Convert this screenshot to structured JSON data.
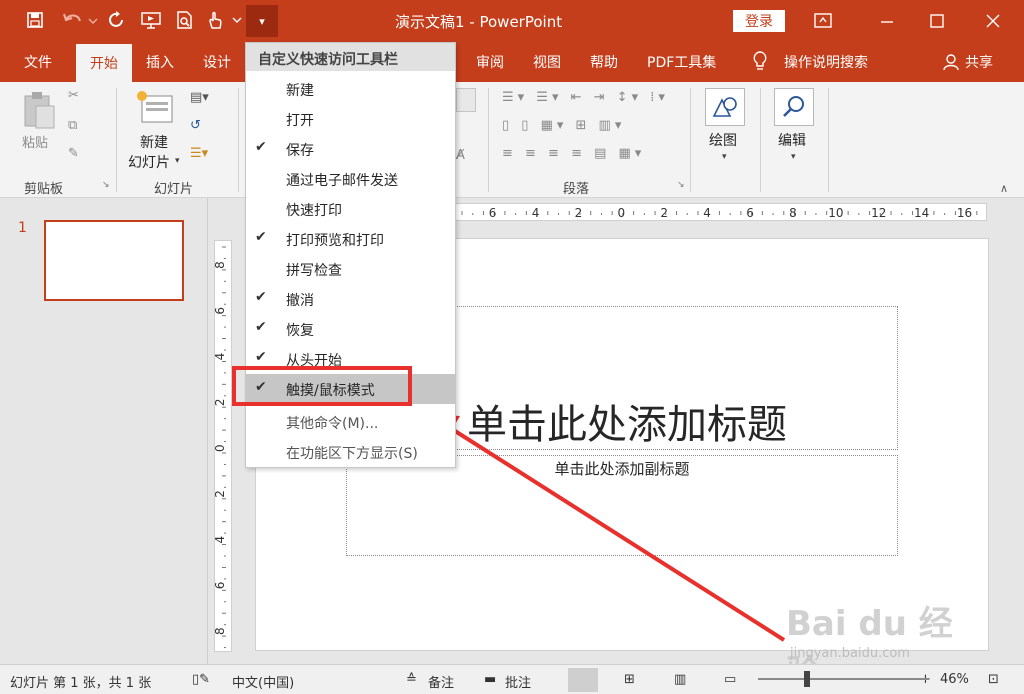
{
  "app": {
    "doc_title": "演示文稿1  -  PowerPoint",
    "login": "登录"
  },
  "qat": {
    "dropdown": "▾"
  },
  "tabs": {
    "file": "文件",
    "home": "开始",
    "insert": "插入",
    "design": "设计",
    "review": "审阅",
    "view": "视图",
    "help": "帮助",
    "pdf": "PDF工具集",
    "tell_me": "操作说明搜索",
    "share": "共享"
  },
  "ribbon": {
    "clipboard": {
      "paste": "粘贴",
      "group_label": "剪贴板"
    },
    "slides": {
      "new_slide_line1": "新建",
      "new_slide_line2": "幻灯片",
      "group_label": "幻灯片"
    },
    "paragraph": {
      "group_label": "段落"
    },
    "drawing": {
      "label": "绘图"
    },
    "editing": {
      "label": "编辑"
    }
  },
  "qat_menu": {
    "header": "自定义快速访问工具栏",
    "items": [
      {
        "label": "新建",
        "checked": false
      },
      {
        "label": "打开",
        "checked": false
      },
      {
        "label": "保存",
        "checked": true
      },
      {
        "label": "通过电子邮件发送",
        "checked": false
      },
      {
        "label": "快速打印",
        "checked": false
      },
      {
        "label": "打印预览和打印",
        "checked": true
      },
      {
        "label": "拼写检查",
        "checked": false
      },
      {
        "label": "撤消",
        "checked": true
      },
      {
        "label": "恢复",
        "checked": true
      },
      {
        "label": "从头开始",
        "checked": true
      },
      {
        "label": "触摸/鼠标模式",
        "checked": true,
        "selected": true
      },
      {
        "label": "其他命令(M)...",
        "checked": false
      },
      {
        "label": "在功能区下方显示(S)",
        "checked": false
      }
    ],
    "check_glyph": "✔"
  },
  "slides_pane": {
    "slide_number": "1"
  },
  "slide": {
    "title_placeholder": "单击此处添加标题",
    "subtitle_placeholder": "单击此处添加副标题"
  },
  "ruler": {
    "h_labels": [
      "6",
      "4",
      "2",
      "0",
      "2",
      "4",
      "6",
      "8",
      "10",
      "12",
      "14",
      "16"
    ],
    "v_labels": [
      "8",
      "6",
      "4",
      "2",
      "0",
      "2",
      "4",
      "6",
      "8"
    ]
  },
  "status": {
    "slide_info": "幻灯片 第 1 张，共 1 张",
    "language": "中文(中国)",
    "notes": "备注",
    "comments": "批注",
    "zoom_minus": "−",
    "zoom_plus": "+",
    "zoom": "46%"
  },
  "watermark": {
    "brand": "Bai du 经验",
    "url": "jingyan.baidu.com"
  },
  "colors": {
    "accent": "#c43e1c",
    "highlight": "#e8302c"
  }
}
